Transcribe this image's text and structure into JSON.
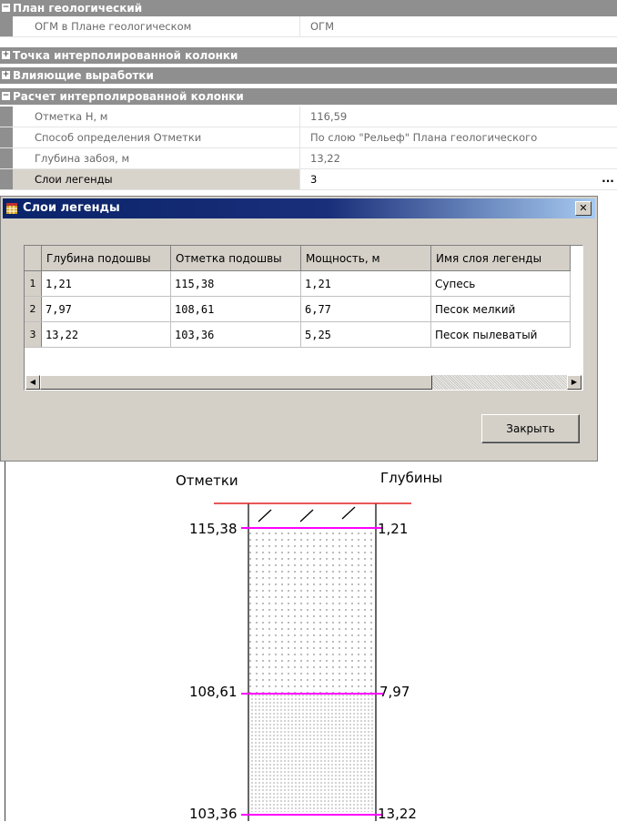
{
  "property_grid": {
    "categories": [
      {
        "toggle": "−",
        "title": "План геологический"
      },
      {
        "toggle": "+",
        "title": "Точка интерполированной колонки"
      },
      {
        "toggle": "+",
        "title": "Влияющие выработки"
      },
      {
        "toggle": "−",
        "title": "Расчет интерполированной колонки"
      }
    ],
    "ogm_row": {
      "label": "ОГМ в Плане геологическом",
      "value": "ОГМ"
    },
    "rows": [
      {
        "label": "Отметка Н, м",
        "value": "116,59"
      },
      {
        "label": "Способ определения Отметки",
        "value": "По слою \"Рельеф\" Плана геологического"
      },
      {
        "label": "Глубина забоя, м",
        "value": "13,22"
      },
      {
        "label": "Слои легенды",
        "value": "3"
      }
    ],
    "ellipsis": "..."
  },
  "dialog": {
    "title": "Слои легенды",
    "close_glyph": "✕",
    "columns": [
      "Глубина подошвы",
      "Отметка подошвы",
      "Мощность, м",
      "Имя слоя легенды"
    ],
    "rows": [
      {
        "n": "1",
        "depth": "1,21",
        "elev": "115,38",
        "thick": "1,21",
        "name": "Супесь"
      },
      {
        "n": "2",
        "depth": "7,97",
        "elev": "108,61",
        "thick": "6,77",
        "name": "Песок мелкий"
      },
      {
        "n": "3",
        "depth": "13,22",
        "elev": "103,36",
        "thick": "5,25",
        "name": "Песок пылеватый"
      }
    ],
    "scroll_left": "◀",
    "scroll_right": "▶",
    "close_button": "Закрыть"
  },
  "column_drawing": {
    "header_elevations": "Отметки",
    "header_depths": "Глубины",
    "layers": [
      {
        "elev": "115,38",
        "depth": "1,21"
      },
      {
        "elev": "108,61",
        "depth": "7,97"
      },
      {
        "elev": "103,36",
        "depth": "13,22"
      }
    ],
    "colors": {
      "surface": "#e02020",
      "boundary": "#ff00ff",
      "outline": "#000000"
    }
  }
}
